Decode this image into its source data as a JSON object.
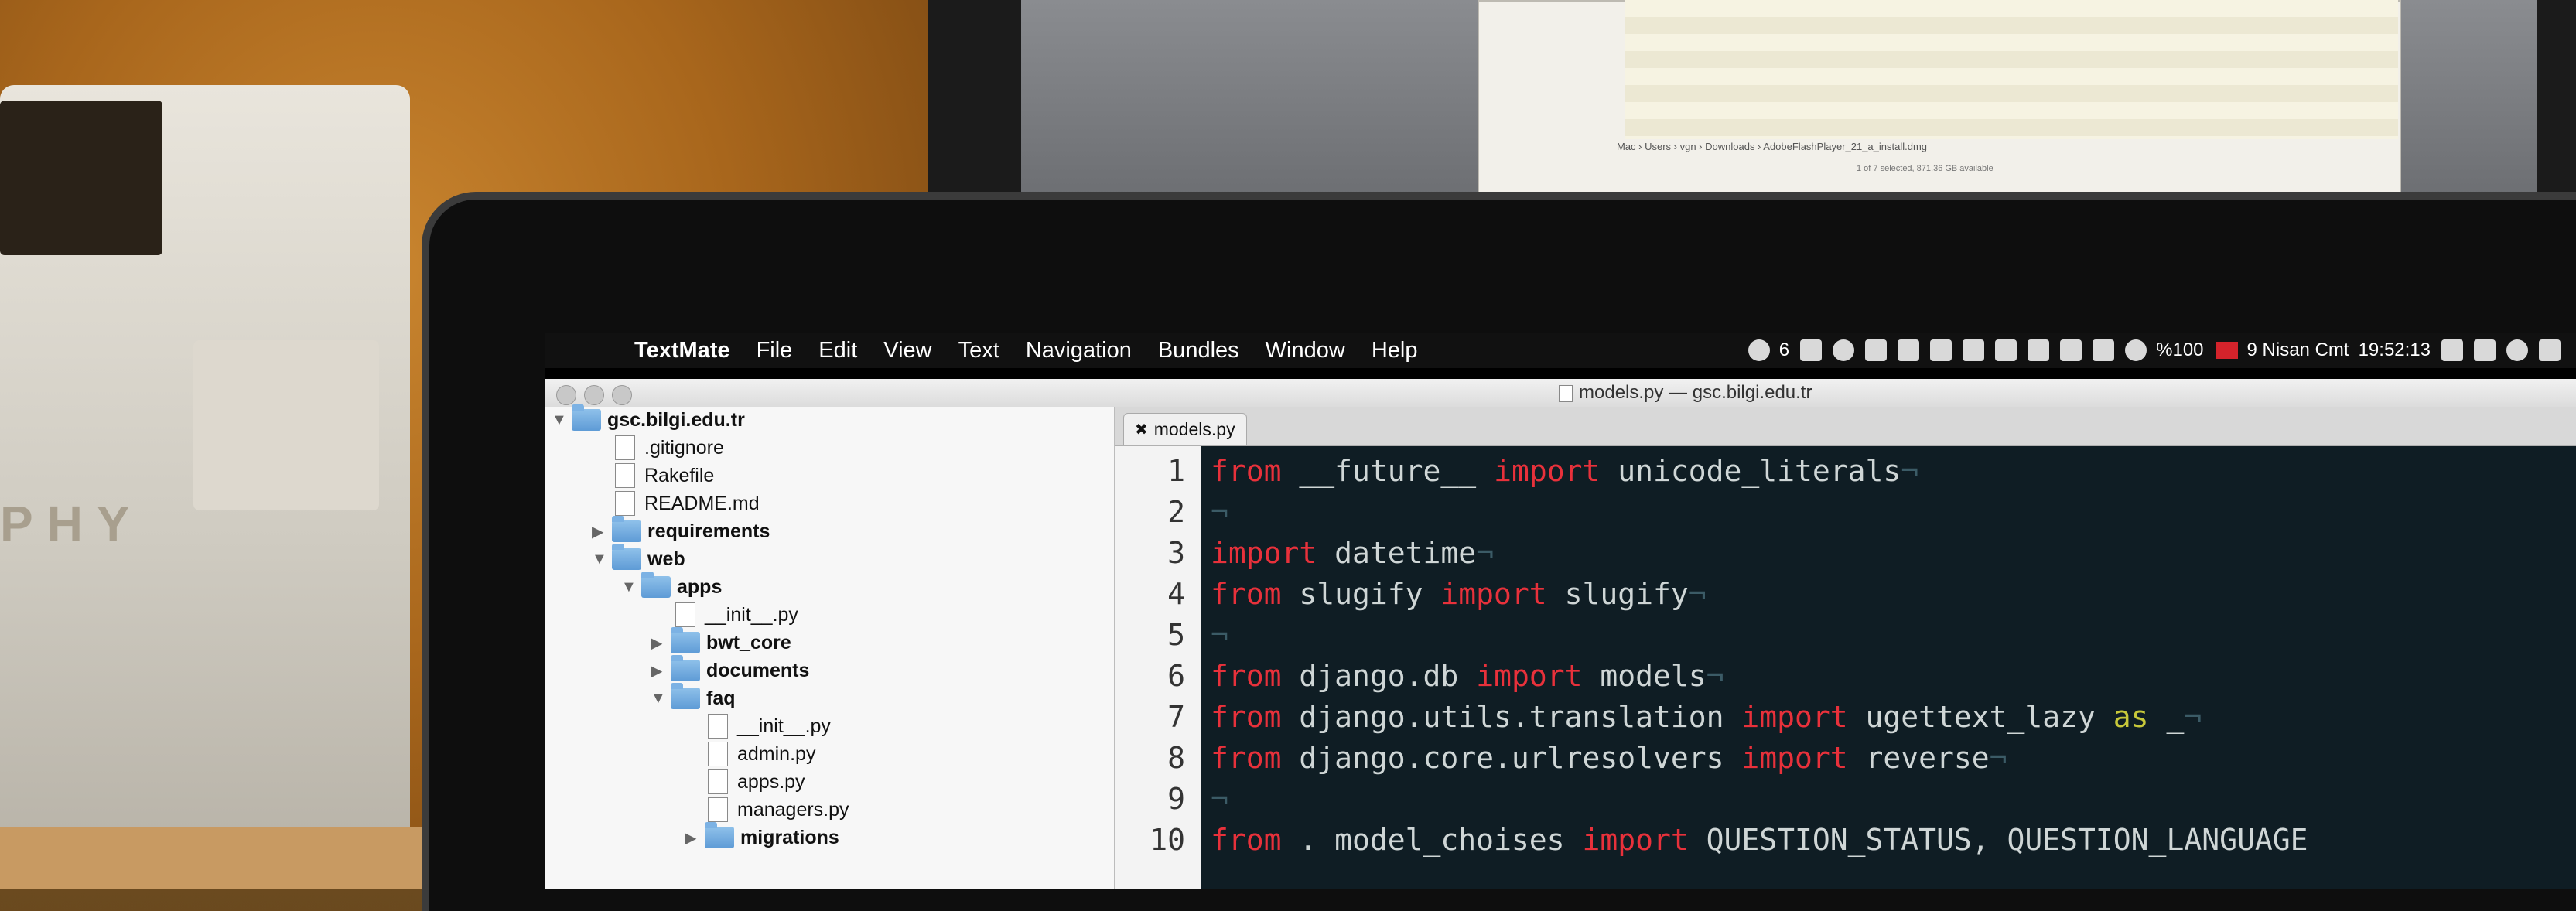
{
  "menubar": {
    "app": "TextMate",
    "items": [
      "File",
      "Edit",
      "View",
      "Text",
      "Navigation",
      "Bundles",
      "Window",
      "Help"
    ],
    "status_badge": "6",
    "battery": "%100",
    "date": "9 Nisan Cmt",
    "time": "19:52:13"
  },
  "window": {
    "title": "models.py — gsc.bilgi.edu.tr",
    "tab": "models.py"
  },
  "tree": [
    {
      "label": "gsc.bilgi.edu.tr",
      "kind": "folder",
      "open": true
    },
    {
      "label": ".gitignore",
      "kind": "file"
    },
    {
      "label": "Rakefile",
      "kind": "file"
    },
    {
      "label": "README.md",
      "kind": "file"
    },
    {
      "label": "requirements",
      "kind": "folder",
      "open": false
    },
    {
      "label": "web",
      "kind": "folder",
      "open": true
    },
    {
      "label": "apps",
      "kind": "folder",
      "open": true
    },
    {
      "label": "__init__.py",
      "kind": "file"
    },
    {
      "label": "bwt_core",
      "kind": "folder",
      "open": false
    },
    {
      "label": "documents",
      "kind": "folder",
      "open": false
    },
    {
      "label": "faq",
      "kind": "folder",
      "open": true
    },
    {
      "label": "__init__.py",
      "kind": "file"
    },
    {
      "label": "admin.py",
      "kind": "file"
    },
    {
      "label": "apps.py",
      "kind": "file"
    },
    {
      "label": "managers.py",
      "kind": "file"
    },
    {
      "label": "migrations",
      "kind": "folder",
      "open": false
    }
  ],
  "code": {
    "line_numbers": [
      "1",
      "2",
      "3",
      "4",
      "5",
      "6",
      "7",
      "8",
      "9",
      "10"
    ],
    "lines": [
      [
        [
          "from",
          "kw"
        ],
        [
          " __future__ ",
          ""
        ],
        [
          "import",
          "kw"
        ],
        [
          " unicode_literals",
          ""
        ],
        [
          "¬",
          "inv"
        ]
      ],
      [
        [
          "¬",
          "inv"
        ]
      ],
      [
        [
          "import",
          "kw"
        ],
        [
          " datetime",
          ""
        ],
        [
          "¬",
          "inv"
        ]
      ],
      [
        [
          "from",
          "kw"
        ],
        [
          " slugify ",
          ""
        ],
        [
          "import",
          "kw"
        ],
        [
          " slugify",
          ""
        ],
        [
          "¬",
          "inv"
        ]
      ],
      [
        [
          "¬",
          "inv"
        ]
      ],
      [
        [
          "from",
          "kw"
        ],
        [
          " django.db ",
          ""
        ],
        [
          "import",
          "kw"
        ],
        [
          " models",
          ""
        ],
        [
          "¬",
          "inv"
        ]
      ],
      [
        [
          "from",
          "kw"
        ],
        [
          " django.utils.translation ",
          ""
        ],
        [
          "import",
          "kw"
        ],
        [
          " ugettext_lazy ",
          ""
        ],
        [
          "as",
          "yl"
        ],
        [
          " _",
          ""
        ],
        [
          "¬",
          "inv"
        ]
      ],
      [
        [
          "from",
          "kw"
        ],
        [
          " django.core.urlresolvers ",
          ""
        ],
        [
          "import",
          "kw"
        ],
        [
          " reverse",
          ""
        ],
        [
          "¬",
          "inv"
        ]
      ],
      [
        [
          "¬",
          "inv"
        ]
      ],
      [
        [
          "from",
          "kw"
        ],
        [
          " . model_choises ",
          ""
        ],
        [
          "import",
          "kw"
        ],
        [
          " QUESTION_STATUS, QUESTION_LANGUAGE",
          ""
        ]
      ]
    ]
  },
  "finder": {
    "path": "Mac › Users › vgn › Downloads › AdobeFlashPlayer_21_a_install.dmg",
    "status": "1 of 7 selected, 871,36 GB available"
  },
  "printer": {
    "brand_text": "PHY"
  },
  "colors": {
    "keyword": "#e8313b",
    "code_bg": "#0f1d24",
    "as_keyword": "#c7c83a"
  }
}
